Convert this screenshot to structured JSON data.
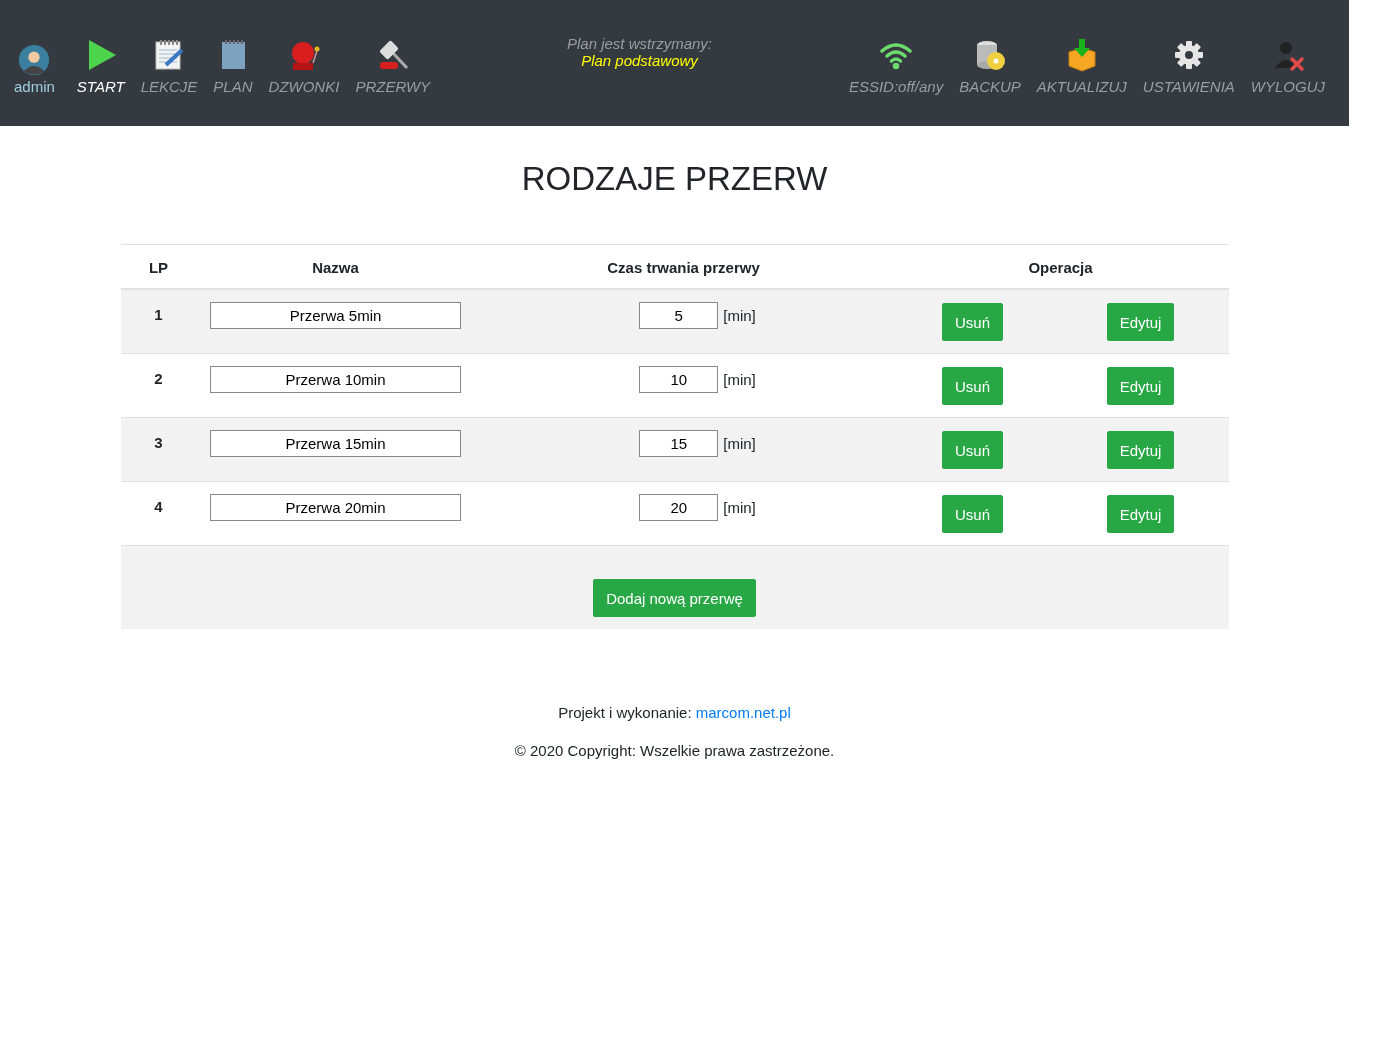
{
  "user": {
    "name": "admin"
  },
  "nav_left": [
    {
      "label": "START",
      "selected": true
    },
    {
      "label": "LEKCJE",
      "selected": false
    },
    {
      "label": "PLAN",
      "selected": false
    },
    {
      "label": "DZWONKI",
      "selected": false
    },
    {
      "label": "PRZERWY",
      "selected": false
    }
  ],
  "plan_status": {
    "text": "Plan jest wstrzymany:",
    "plan": "Plan podstawowy"
  },
  "nav_right": [
    {
      "label": "ESSID:off/any"
    },
    {
      "label": "BACKUP"
    },
    {
      "label": "AKTUALIZUJ"
    },
    {
      "label": "USTAWIENIA"
    },
    {
      "label": "WYLOGUJ"
    }
  ],
  "title": "RODZAJE PRZERW",
  "table": {
    "columns": [
      "LP",
      "Nazwa",
      "Czas trwania przerwy",
      "Operacja"
    ],
    "rows": [
      {
        "lp": "1",
        "name": "Przerwa 5min",
        "duration": "5",
        "unit": "[min]",
        "delete": "Usuń",
        "edit": "Edytuj"
      },
      {
        "lp": "2",
        "name": "Przerwa 10min",
        "duration": "10",
        "unit": "[min]",
        "delete": "Usuń",
        "edit": "Edytuj"
      },
      {
        "lp": "3",
        "name": "Przerwa 15min",
        "duration": "15",
        "unit": "[min]",
        "delete": "Usuń",
        "edit": "Edytuj"
      },
      {
        "lp": "4",
        "name": "Przerwa 20min",
        "duration": "20",
        "unit": "[min]",
        "delete": "Usuń",
        "edit": "Edytuj"
      }
    ],
    "add_button": "Dodaj nową przerwę"
  },
  "footer": {
    "credit": "Projekt i wykonanie:",
    "link": "marcom.net.pl",
    "copyright": "© 2020 Copyright: Wszelkie prawa zastrzeżone."
  }
}
